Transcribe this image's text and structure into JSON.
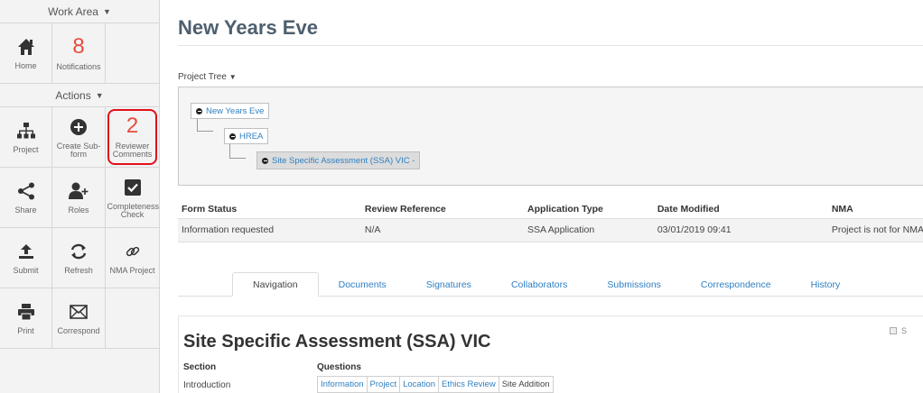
{
  "sidebar": {
    "work_area": "Work Area",
    "actions": "Actions",
    "home": {
      "label": "Home",
      "icon": "home-icon"
    },
    "notifications": {
      "count": "8",
      "label": "Notifications"
    },
    "project": {
      "label": "Project",
      "icon": "hierarchy-icon"
    },
    "create_sub_form": {
      "label": "Create Sub-form",
      "icon": "plus-circle-icon"
    },
    "reviewer_comments": {
      "count": "2",
      "label": "Reviewer Comments"
    },
    "share": {
      "label": "Share",
      "icon": "share-icon"
    },
    "roles": {
      "label": "Roles",
      "icon": "add-user-icon"
    },
    "completeness_check": {
      "label": "Completeness Check",
      "icon": "checkbox-icon"
    },
    "submit": {
      "label": "Submit",
      "icon": "upload-icon"
    },
    "refresh": {
      "label": "Refresh",
      "icon": "refresh-icon"
    },
    "nma_project": {
      "label": "NMA Project",
      "icon": "link-icon"
    },
    "print": {
      "label": "Print",
      "icon": "printer-icon"
    },
    "correspond": {
      "label": "Correspond",
      "icon": "envelope-icon"
    }
  },
  "main": {
    "title": "New Years Eve",
    "project_tree_label": "Project Tree",
    "tree": [
      "New Years Eve",
      "HREA",
      "Site Specific Assessment (SSA) VIC -"
    ],
    "table": {
      "headers": [
        "Form Status",
        "Review Reference",
        "Application Type",
        "Date Modified",
        "NMA"
      ],
      "row": [
        "Information requested",
        "N/A",
        "SSA Application",
        "03/01/2019 09:41",
        "Project is not for NMA"
      ]
    },
    "tabs": [
      "Navigation",
      "Documents",
      "Signatures",
      "Collaborators",
      "Submissions",
      "Correspondence",
      "History"
    ],
    "section_title": "Site Specific Assessment (SSA) VIC",
    "checkbox_label": "S",
    "col_section": "Section",
    "col_questions": "Questions",
    "intro_label": "Introduction",
    "question_links": [
      "Information",
      "Project",
      "Location",
      "Ethics Review",
      "Site Addition"
    ]
  },
  "colors": {
    "accent_link": "#2f7fc1",
    "notification_red": "#e74c3c",
    "highlight_border": "#e0101b"
  }
}
